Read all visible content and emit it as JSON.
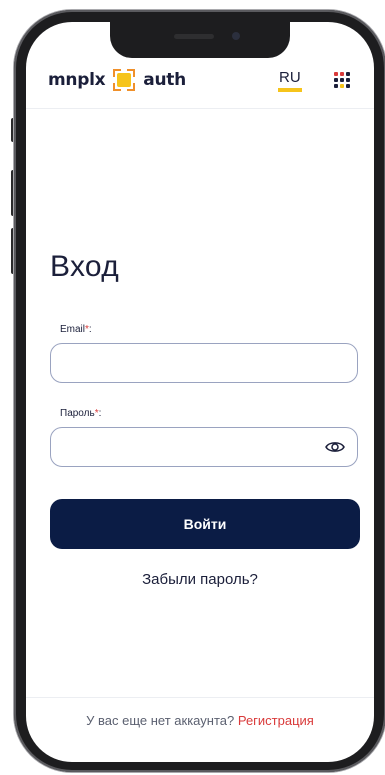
{
  "header": {
    "logo_left": "mnplx",
    "logo_right": "auth",
    "language": "RU",
    "apps_icon": "grid-apps-icon",
    "apps_colors": [
      "#d93a3a",
      "#d93a3a",
      "#1b1f3a",
      "#1b1f3a",
      "#1b1f3a",
      "#1b1f3a",
      "#1b1f3a",
      "#f6c41b",
      "#1b1f3a"
    ]
  },
  "form": {
    "title": "Вход",
    "email_label": "Email",
    "email_value": "",
    "password_label": "Пароль",
    "password_value": "",
    "required_marker": "*",
    "label_suffix": ":",
    "show_password_icon": "eye-icon",
    "submit_label": "Войти",
    "forgot_label": "Забыли пароль?"
  },
  "footer": {
    "prompt": "У вас еще нет аккаунта?",
    "register_label": "Регистрация"
  },
  "colors": {
    "brand_dark": "#0b1c45",
    "accent_yellow": "#f6c41b",
    "accent_red": "#d93a3a"
  }
}
